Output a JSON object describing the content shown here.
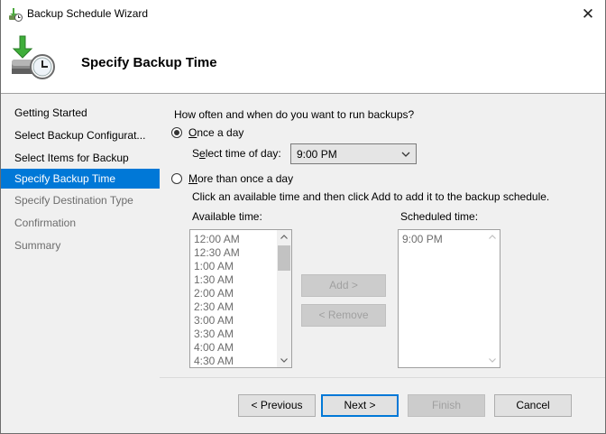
{
  "window": {
    "title": "Backup Schedule Wizard",
    "close_glyph": "✕",
    "app_icon": "backup-clock-icon"
  },
  "header": {
    "title": "Specify Backup Time",
    "icon": "backup-schedule-icon"
  },
  "sidebar": {
    "items": [
      {
        "label": "Getting Started",
        "state": "done"
      },
      {
        "label": "Select Backup Configurat...",
        "state": "done"
      },
      {
        "label": "Select Items for Backup",
        "state": "done"
      },
      {
        "label": "Specify Backup Time",
        "state": "active"
      },
      {
        "label": "Specify Destination Type",
        "state": "pending"
      },
      {
        "label": "Confirmation",
        "state": "pending"
      },
      {
        "label": "Summary",
        "state": "pending"
      }
    ]
  },
  "main": {
    "question": "How often and when do you want to run backups?",
    "once_a_day_label": "Once a day",
    "once_a_day_selected": true,
    "select_time_label": "Select time of day:",
    "select_time_value": "9:00 PM",
    "more_than_once_label": "More than once a day",
    "more_than_once_selected": false,
    "instructions": "Click an available time and then click Add to add it to the backup schedule.",
    "available_label": "Available time:",
    "available_times": [
      "12:00 AM",
      "12:30 AM",
      "1:00 AM",
      "1:30 AM",
      "2:00 AM",
      "2:30 AM",
      "3:00 AM",
      "3:30 AM",
      "4:00 AM",
      "4:30 AM"
    ],
    "scheduled_label": "Scheduled time:",
    "scheduled_times": [
      "9:00 PM"
    ],
    "add_button": "Add >",
    "remove_button": "< Remove"
  },
  "footer": {
    "previous": "< Previous",
    "next": "Next >",
    "finish": "Finish",
    "cancel": "Cancel"
  },
  "colors": {
    "accent": "#0078d7",
    "panel": "#f0f0f0",
    "disabled_text": "#a0a0a0"
  }
}
